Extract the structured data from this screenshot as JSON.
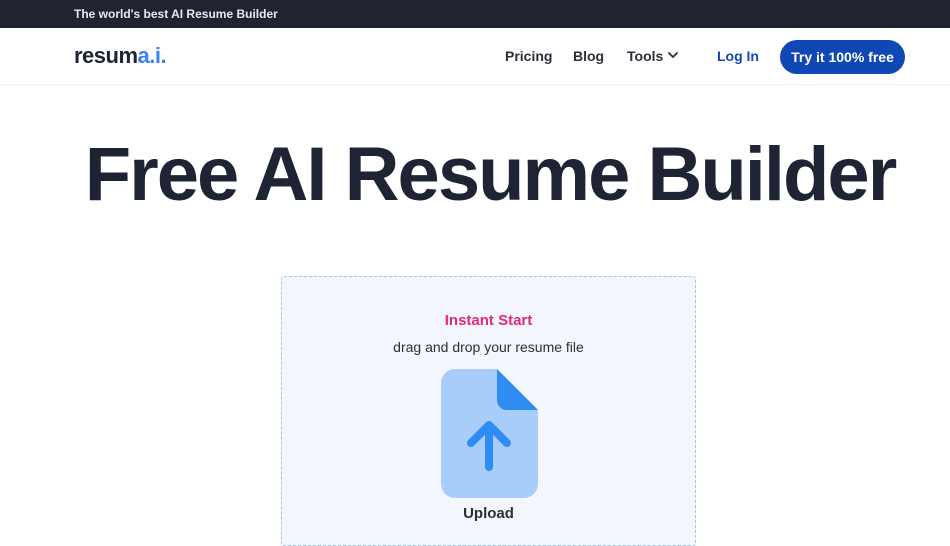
{
  "banner": {
    "text": "The world's best AI Resume Builder"
  },
  "logo": {
    "main": "resum",
    "accent": "a.i."
  },
  "nav": {
    "pricing": "Pricing",
    "blog": "Blog",
    "tools": "Tools",
    "login": "Log In",
    "cta": "Try it 100% free"
  },
  "hero": {
    "title": "Free AI Resume Builder"
  },
  "upload": {
    "heading": "Instant Start",
    "subtitle": "drag and drop your resume file",
    "label": "Upload",
    "icon": "file-upload-icon"
  },
  "colors": {
    "banner_bg": "#1f2430",
    "brand_blue": "#0f47b5",
    "accent_pink": "#e0287c",
    "icon_light": "#a9cdfa",
    "icon_dark": "#2f8cf2"
  }
}
